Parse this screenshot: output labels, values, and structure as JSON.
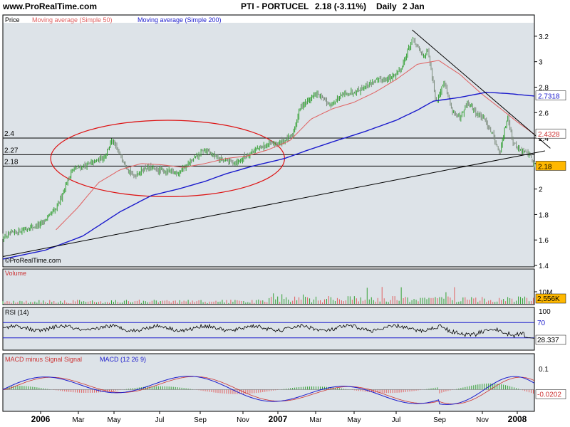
{
  "header": {
    "site": "www.ProRealTime.com",
    "title": "PTI - PORTUCEL",
    "quote": "2.18 (-3.11%)",
    "period": "Daily",
    "date": "2 Jan"
  },
  "watermark": "©ProRealTime.com",
  "x_labels": [
    "2006",
    "Mar",
    "May",
    "Jul",
    "Sep",
    "Nov",
    "2007",
    "Mar",
    "May",
    "Jul",
    "Sep",
    "Nov",
    "2008"
  ],
  "colors": {
    "panel_bg": "#dde3e8",
    "candle": "#33a033",
    "ma50": "#e06060",
    "ma200": "#1a1acc",
    "ellipse": "#dd1111"
  },
  "chart_data": [
    {
      "type": "line",
      "panel": "price",
      "legend": {
        "price": "Price",
        "ma50": "Moving average (Simple 50)",
        "ma200": "Moving average (Simple 200)"
      },
      "ylim": [
        1.4,
        3.3
      ],
      "y_ticks": [
        "3.2",
        "3",
        "2.8",
        "2.6",
        "2.4",
        "2.2",
        "2",
        "1.8",
        "1.6",
        "1.4"
      ],
      "y_tick_values": [
        3.2,
        3.0,
        2.8,
        2.6,
        2.4,
        2.2,
        2.0,
        1.8,
        1.6,
        1.4
      ],
      "hlines": [
        {
          "label": "2.4",
          "value": 2.4
        },
        {
          "label": "2.27",
          "value": 2.27
        },
        {
          "label": "2.18",
          "value": 2.18
        }
      ],
      "value_labels": {
        "ma200": "2.7318",
        "ma50": "2.4328",
        "last": "2.18"
      },
      "price_keys": [
        {
          "x": 0.0,
          "y": 1.62
        },
        {
          "x": 0.03,
          "y": 1.67
        },
        {
          "x": 0.07,
          "y": 1.72
        },
        {
          "x": 0.1,
          "y": 1.84
        },
        {
          "x": 0.13,
          "y": 2.15
        },
        {
          "x": 0.16,
          "y": 2.19
        },
        {
          "x": 0.19,
          "y": 2.25
        },
        {
          "x": 0.205,
          "y": 2.38
        },
        {
          "x": 0.22,
          "y": 2.27
        },
        {
          "x": 0.245,
          "y": 2.1
        },
        {
          "x": 0.27,
          "y": 2.17
        },
        {
          "x": 0.3,
          "y": 2.14
        },
        {
          "x": 0.33,
          "y": 2.13
        },
        {
          "x": 0.355,
          "y": 2.22
        },
        {
          "x": 0.38,
          "y": 2.31
        },
        {
          "x": 0.41,
          "y": 2.23
        },
        {
          "x": 0.44,
          "y": 2.21
        },
        {
          "x": 0.47,
          "y": 2.3
        },
        {
          "x": 0.5,
          "y": 2.35
        },
        {
          "x": 0.52,
          "y": 2.36
        },
        {
          "x": 0.545,
          "y": 2.42
        },
        {
          "x": 0.56,
          "y": 2.65
        },
        {
          "x": 0.59,
          "y": 2.75
        },
        {
          "x": 0.615,
          "y": 2.66
        },
        {
          "x": 0.64,
          "y": 2.74
        },
        {
          "x": 0.67,
          "y": 2.78
        },
        {
          "x": 0.7,
          "y": 2.85
        },
        {
          "x": 0.73,
          "y": 2.87
        },
        {
          "x": 0.75,
          "y": 2.95
        },
        {
          "x": 0.77,
          "y": 3.18
        },
        {
          "x": 0.79,
          "y": 3.05
        },
        {
          "x": 0.8,
          "y": 3.08
        },
        {
          "x": 0.815,
          "y": 2.68
        },
        {
          "x": 0.83,
          "y": 2.85
        },
        {
          "x": 0.845,
          "y": 2.62
        },
        {
          "x": 0.86,
          "y": 2.55
        },
        {
          "x": 0.875,
          "y": 2.68
        },
        {
          "x": 0.89,
          "y": 2.6
        },
        {
          "x": 0.905,
          "y": 2.55
        },
        {
          "x": 0.92,
          "y": 2.45
        },
        {
          "x": 0.935,
          "y": 2.28
        },
        {
          "x": 0.95,
          "y": 2.58
        },
        {
          "x": 0.96,
          "y": 2.36
        },
        {
          "x": 0.975,
          "y": 2.3
        },
        {
          "x": 0.99,
          "y": 2.28
        },
        {
          "x": 1.0,
          "y": 2.18
        }
      ],
      "ma200_keys": [
        {
          "x": 0.0,
          "y": 1.45
        },
        {
          "x": 0.08,
          "y": 1.52
        },
        {
          "x": 0.15,
          "y": 1.63
        },
        {
          "x": 0.22,
          "y": 1.82
        },
        {
          "x": 0.28,
          "y": 1.95
        },
        {
          "x": 0.33,
          "y": 2.0
        },
        {
          "x": 0.38,
          "y": 2.06
        },
        {
          "x": 0.42,
          "y": 2.12
        },
        {
          "x": 0.47,
          "y": 2.18
        },
        {
          "x": 0.53,
          "y": 2.24
        },
        {
          "x": 0.57,
          "y": 2.3
        },
        {
          "x": 0.62,
          "y": 2.37
        },
        {
          "x": 0.68,
          "y": 2.45
        },
        {
          "x": 0.74,
          "y": 2.54
        },
        {
          "x": 0.78,
          "y": 2.62
        },
        {
          "x": 0.81,
          "y": 2.69
        },
        {
          "x": 0.86,
          "y": 2.72
        },
        {
          "x": 0.91,
          "y": 2.76
        },
        {
          "x": 0.95,
          "y": 2.75
        },
        {
          "x": 1.0,
          "y": 2.73
        }
      ],
      "ma50_keys": [
        {
          "x": 0.1,
          "y": 1.68
        },
        {
          "x": 0.14,
          "y": 1.85
        },
        {
          "x": 0.18,
          "y": 2.05
        },
        {
          "x": 0.22,
          "y": 2.15
        },
        {
          "x": 0.26,
          "y": 2.2
        },
        {
          "x": 0.3,
          "y": 2.19
        },
        {
          "x": 0.34,
          "y": 2.17
        },
        {
          "x": 0.38,
          "y": 2.2
        },
        {
          "x": 0.42,
          "y": 2.24
        },
        {
          "x": 0.46,
          "y": 2.26
        },
        {
          "x": 0.5,
          "y": 2.31
        },
        {
          "x": 0.54,
          "y": 2.38
        },
        {
          "x": 0.58,
          "y": 2.55
        },
        {
          "x": 0.62,
          "y": 2.63
        },
        {
          "x": 0.66,
          "y": 2.68
        },
        {
          "x": 0.7,
          "y": 2.76
        },
        {
          "x": 0.74,
          "y": 2.86
        },
        {
          "x": 0.78,
          "y": 2.98
        },
        {
          "x": 0.82,
          "y": 3.01
        },
        {
          "x": 0.86,
          "y": 2.9
        },
        {
          "x": 0.9,
          "y": 2.75
        },
        {
          "x": 0.94,
          "y": 2.62
        },
        {
          "x": 0.97,
          "y": 2.52
        },
        {
          "x": 1.0,
          "y": 2.43
        }
      ],
      "trendlines": [
        {
          "x1": 0.0,
          "y1": 1.47,
          "x2": 1.02,
          "y2": 2.3
        },
        {
          "x1": 0.77,
          "y1": 3.25,
          "x2": 1.03,
          "y2": 2.32
        }
      ],
      "ellipse": {
        "cx": 0.31,
        "cy": 2.24,
        "rx": 0.22,
        "ry_value": 0.3
      }
    },
    {
      "type": "bar",
      "panel": "volume",
      "legend": "Volume",
      "y_ticks": [
        "10M"
      ],
      "last_label": "2,556K",
      "volume_max": 10000000
    },
    {
      "type": "line",
      "panel": "rsi",
      "legend": "RSI (14)",
      "ylim": [
        0,
        100
      ],
      "y_ticks": [
        "100",
        "70"
      ],
      "levels": [
        70,
        30
      ],
      "last_label": "28.337"
    },
    {
      "type": "line",
      "panel": "macd",
      "legend": {
        "hist": "MACD minus Signal Signal",
        "macd": "MACD (12 26 9)"
      },
      "ylim": [
        -0.1,
        0.12
      ],
      "y_ticks": [
        "0.1"
      ],
      "last_label": "-0.0202"
    }
  ]
}
